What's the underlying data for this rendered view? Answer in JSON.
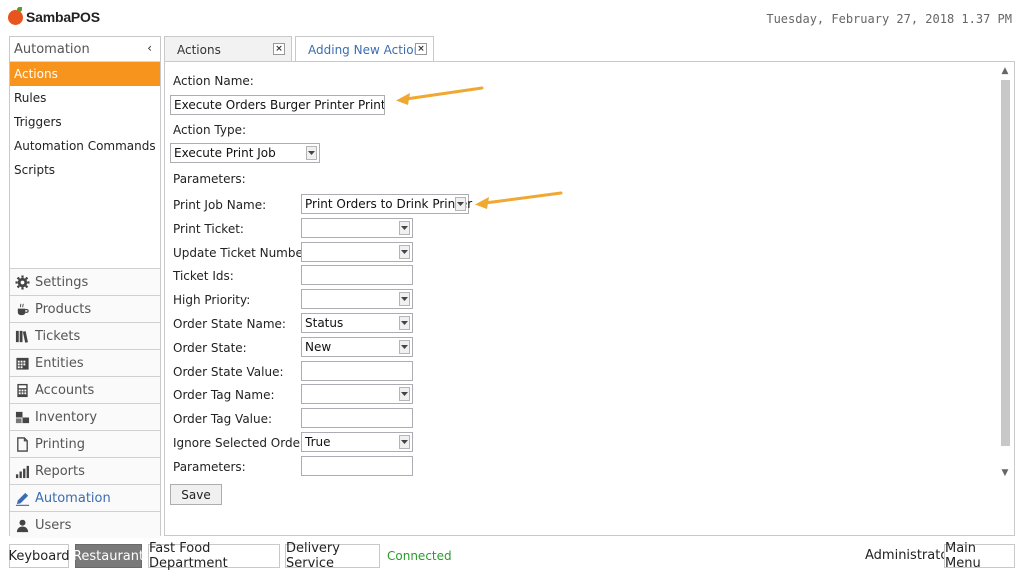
{
  "app": {
    "name": "SambaPOS",
    "datetime": "Tuesday, February 27, 2018 1.37 PM"
  },
  "sidebar": {
    "header": "Automation",
    "collapse_glyph": "‹",
    "items": [
      {
        "label": "Actions"
      },
      {
        "label": "Rules"
      },
      {
        "label": "Triggers"
      },
      {
        "label": "Automation Commands"
      },
      {
        "label": "Scripts"
      }
    ],
    "nav": [
      {
        "label": "Settings",
        "icon": "gear-icon"
      },
      {
        "label": "Products",
        "icon": "coffee-cup-icon"
      },
      {
        "label": "Tickets",
        "icon": "books-icon"
      },
      {
        "label": "Entities",
        "icon": "calendar-icon"
      },
      {
        "label": "Accounts",
        "icon": "calculator-icon"
      },
      {
        "label": "Inventory",
        "icon": "boxes-icon"
      },
      {
        "label": "Printing",
        "icon": "document-icon"
      },
      {
        "label": "Reports",
        "icon": "bar-chart-icon"
      },
      {
        "label": "Automation",
        "icon": "pencil-icon"
      },
      {
        "label": "Users",
        "icon": "user-icon"
      }
    ]
  },
  "tabs": [
    {
      "label": "Actions",
      "close": "×"
    },
    {
      "label": "Adding New Action",
      "close": "×"
    }
  ],
  "form": {
    "action_name_label": "Action Name:",
    "action_name_value": "Execute Orders Burger Printer Print Job",
    "action_type_label": "Action Type:",
    "action_type_value": "Execute Print Job",
    "parameters_header": "Parameters:",
    "params": [
      {
        "label": "Print Job Name:",
        "value": "Print Orders to Drink Printer",
        "kind": "combo"
      },
      {
        "label": "Print Ticket:",
        "value": "",
        "kind": "combo"
      },
      {
        "label": "Update Ticket Number:",
        "value": "",
        "kind": "combo"
      },
      {
        "label": "Ticket Ids:",
        "value": "",
        "kind": "text"
      },
      {
        "label": "High Priority:",
        "value": "",
        "kind": "combo"
      },
      {
        "label": "Order State Name:",
        "value": "Status",
        "kind": "combo"
      },
      {
        "label": "Order State:",
        "value": "New",
        "kind": "combo"
      },
      {
        "label": "Order State Value:",
        "value": "",
        "kind": "text"
      },
      {
        "label": "Order Tag Name:",
        "value": "",
        "kind": "combo"
      },
      {
        "label": "Order Tag Value:",
        "value": "",
        "kind": "text"
      },
      {
        "label": "Ignore Selected Orders:",
        "value": "True",
        "kind": "combo"
      },
      {
        "label": "Parameters:",
        "value": "",
        "kind": "text"
      }
    ],
    "save_label": "Save"
  },
  "footer": {
    "keyboard": "Keyboard",
    "restaurant": "Restaurant",
    "fast_food": "Fast Food Department",
    "delivery": "Delivery Service",
    "status": "Connected",
    "user": "Administrator",
    "main_menu": "Main Menu"
  },
  "colors": {
    "accent": "#f7941d",
    "link": "#3b6db0",
    "status_ok": "#2a9b2a",
    "annotation_arrow": "#f0a830"
  }
}
